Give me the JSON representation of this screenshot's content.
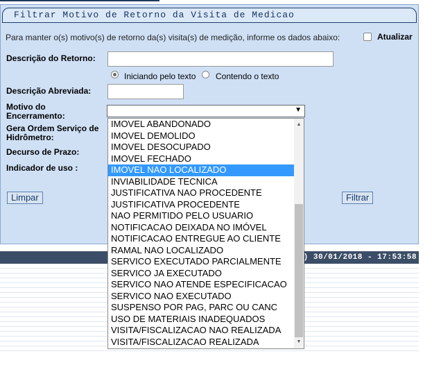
{
  "window": {
    "title": "Filtrar Motivo de Retorno da Visita de Medicao"
  },
  "form": {
    "instructions": "Para manter o(s) motivo(s) de retorno da(s) visita(s) de medição, informe os dados abaixo:",
    "update_label": "Atualizar",
    "descricao_label": "Descrição do Retorno:",
    "descricao_value": "",
    "radio_start_label": "Iniciando pelo texto",
    "radio_contains_label": "Contendo o texto",
    "abreviada_label": "Descrição Abreviada:",
    "abreviada_value": "",
    "motivo_label": "Motivo do Encerramento:",
    "motivo_value": "",
    "gera_label": "Gera Ordem Serviço de Hidrômetro:",
    "decurso_label": "Decurso de Prazo:",
    "indicador_label": "Indicador de uso :",
    "limpar_label": "Limpar",
    "filtrar_label": "Filtrar"
  },
  "status": {
    "text": "tch) 30/01/2018 - 17:53:58"
  },
  "dropdown": {
    "selected_index": 4,
    "options": [
      "IMOVEL ABANDONADO",
      "IMOVEL DEMOLIDO",
      "IMOVEL DESOCUPADO",
      "IMOVEL FECHADO",
      "IMOVEL NAO LOCALIZADO",
      "INVIABILIDADE TECNICA",
      "JUSTIFICATIVA NAO PROCEDENTE",
      "JUSTIFICATIVA PROCEDENTE",
      "NAO PERMITIDO PELO USUARIO",
      "NOTIFICACAO DEIXADA NO IMÓVEL",
      "NOTIFICACAO ENTREGUE AO CLIENTE",
      "RAMAL NAO LOCALIZADO",
      "SERVICO EXECUTADO PARCIALMENTE",
      "SERVICO JA EXECUTADO",
      "SERVICO NAO ATENDE ESPECIFICACAO",
      "SERVICO NAO EXECUTADO",
      "SUSPENSO POR PAG, PARC OU CANC",
      "USO DE MATERIAIS INADEQUADOS",
      "VISITA/FISCALIZACAO NAO REALIZADA",
      "VISITA/FISCALIZACAO REALIZADA"
    ]
  },
  "colors": {
    "selection": "#3399ff",
    "panel": "#cfe0f5",
    "statusbar": "#3c4e67"
  }
}
